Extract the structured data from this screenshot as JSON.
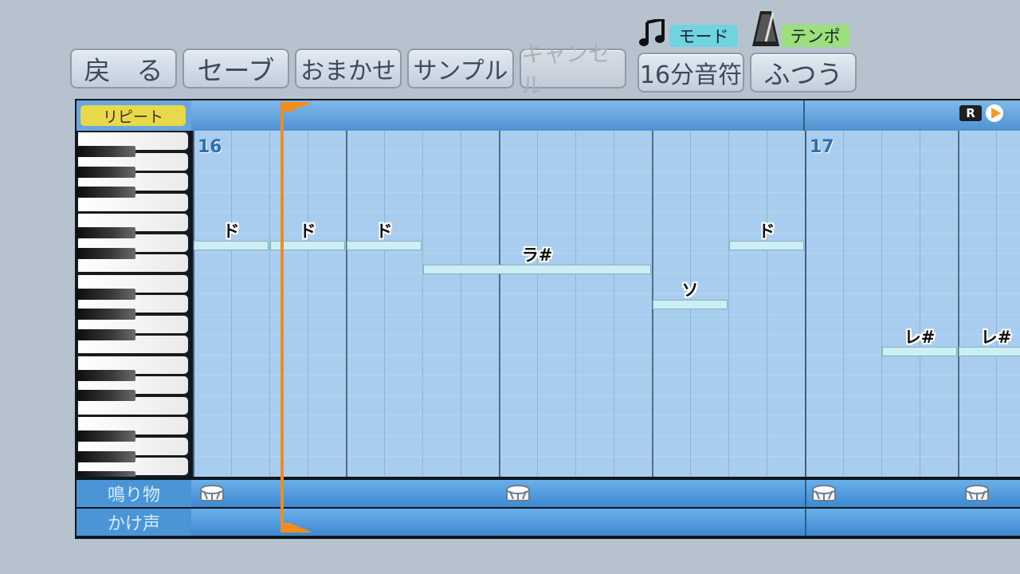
{
  "toolbar": {
    "buttons": [
      {
        "id": "back",
        "label": "戻　る",
        "enabled": true
      },
      {
        "id": "save",
        "label": "セーブ",
        "enabled": true
      },
      {
        "id": "auto",
        "label": "おまかせ",
        "enabled": true
      },
      {
        "id": "sample",
        "label": "サンプル",
        "enabled": true
      },
      {
        "id": "cancel",
        "label": "キャンセル",
        "enabled": false
      }
    ],
    "mode": {
      "label": "モード",
      "value": "16分音符",
      "icon": "music-note-icon"
    },
    "tempo": {
      "label": "テンポ",
      "value": "ふつう",
      "icon": "metronome-icon"
    }
  },
  "sequencer": {
    "repeat_label": "リピート",
    "r_badge": "R",
    "bars": [
      "16",
      "17"
    ],
    "notes": [
      {
        "label": "ド",
        "step": 0,
        "length": 1,
        "row": 1
      },
      {
        "label": "ド",
        "step": 1,
        "length": 1,
        "row": 1
      },
      {
        "label": "ド",
        "step": 2,
        "length": 1,
        "row": 1
      },
      {
        "label": "ラ#",
        "step": 3,
        "length": 3,
        "row": 2
      },
      {
        "label": "ソ",
        "step": 6,
        "length": 1,
        "row": 3
      },
      {
        "label": "ド",
        "step": 7,
        "length": 1,
        "row": 1
      },
      {
        "label": "レ#",
        "step": 9,
        "length": 1,
        "row": 4
      },
      {
        "label": "レ#",
        "step": 10,
        "length": 1,
        "row": 4
      }
    ],
    "tracks": [
      {
        "name": "鳴り物",
        "drum_steps": [
          0,
          4,
          8,
          10
        ]
      },
      {
        "name": "かけ声",
        "drum_steps": []
      }
    ]
  },
  "colors": {
    "accent": "#f28c1c",
    "mode_label_bg": "#6fd3e0",
    "tempo_label_bg": "#9be07a",
    "repeat_bg": "#e8d94a"
  }
}
